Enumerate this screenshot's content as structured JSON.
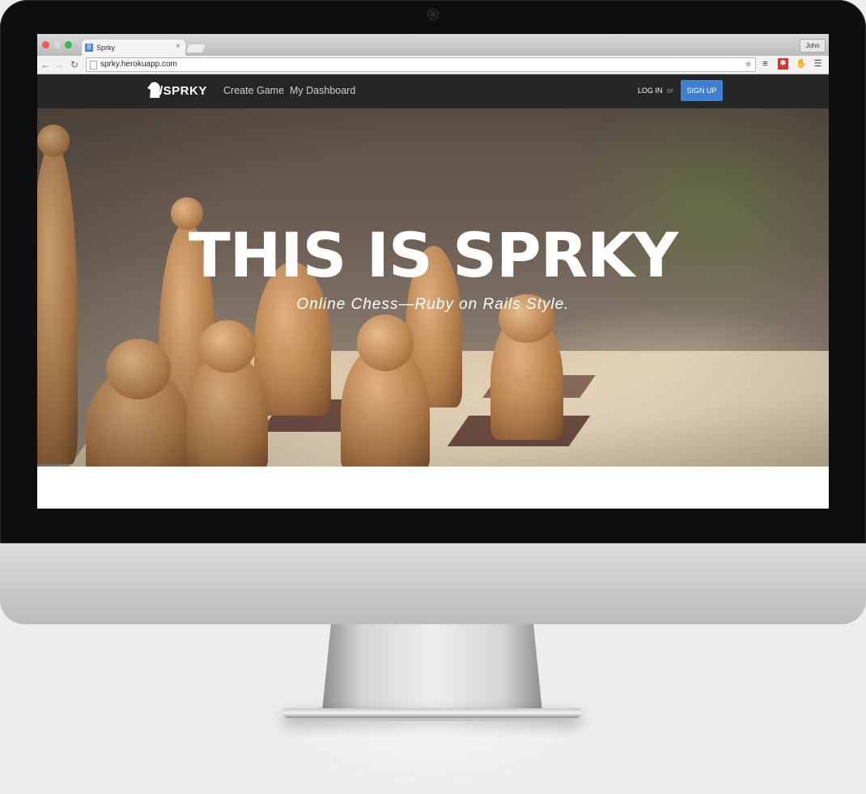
{
  "browser": {
    "tab_title": "Sprky",
    "tab_favicon": "8",
    "tab_close": "×",
    "user_button": "John",
    "url": "sprky.herokuapp.com",
    "icons": [
      "back-arrow-icon",
      "forward-arrow-icon",
      "reload-icon",
      "bookmark-star-icon",
      "buffer-stack-icon",
      "red-extension-icon",
      "hand-extension-icon",
      "menu-icon"
    ]
  },
  "site": {
    "logo_text": "/SPRKY",
    "nav": [
      "Create Game",
      "My Dashboard"
    ],
    "login": "LOG IN",
    "or": "or",
    "signup": "SIGN UP",
    "accent": "#3f7fcf",
    "navbar_color": "#262626"
  },
  "hero": {
    "title": "THIS IS SPRKY",
    "subtitle": "Online Chess—Ruby on Rails Style."
  }
}
